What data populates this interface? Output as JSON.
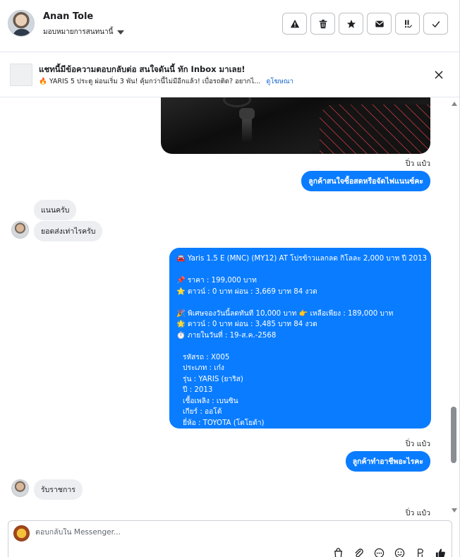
{
  "header": {
    "name": "Anan Tole",
    "assign_label": "มอบหมายการสนทนานี้",
    "actions": [
      {
        "icon": "alert-icon",
        "glyph": "!"
      },
      {
        "icon": "trash-icon",
        "glyph": "🗑"
      },
      {
        "icon": "star-icon",
        "glyph": "★"
      },
      {
        "icon": "envelope-icon",
        "glyph": "✉"
      },
      {
        "icon": "follow-up-icon",
        "glyph": "!!"
      },
      {
        "icon": "check-icon",
        "glyph": "✓"
      }
    ]
  },
  "notice": {
    "title": "แชทนี้มีข้อความตอบกลับต่อ สนใจดันนี้ ทัก Inbox มาเลย!",
    "body": "🔥 YARIS 5 ประตู ผ่อนเริ่ม 3 พัน! คุ้มกว่านี้ไม่มีอีกแล้ว! เบื่อรถติด? อยากไ...",
    "link": "ดูโฆษณา"
  },
  "messages": {
    "sender_1": "ปิ่ว แป๋ว",
    "out_1": "ลูกค้าสนใจซื้อสดหรือจัดไฟแนนซ์คะ",
    "in_1": "แนนครับ",
    "in_2": "ยอดส่งเท่าไรครับ",
    "listing": {
      "title": "🚘 Yaris 1.5 E (MNC) (MY12) AT โปรข้าวแลกลด กิโลละ 2,000 บาท ปี 2013",
      "price": "📌 ราคา : 199,000 บาท",
      "down1": "⭐ ดาวน์ : 0 บาท ผ่อน : 3,669 บาท 84 งวด",
      "special": "🎉 พิเศษจองวันนี้ลดทันที 10,000 บาท 👉 เหลือเพียง : 189,000 บาท",
      "down2": "🌟 ดาวน์ : 0 บาท ผ่อน : 3,485 บาท 84 งวด",
      "deadline": "⏱️ ภายในวันที่ : 19-ส.ค.-2568",
      "code": "รหัสรถ : X005",
      "type": "ประเภท : เก๋ง",
      "model": "รุ่น : YARIS (ยาริส)",
      "year": "ปี : 2013",
      "fuel": "เชื้อเพลิง : เบนซิน",
      "gear": "เกียร์ : ออโต้",
      "brand": "ยี่ห้อ : TOYOTA (โตโยต้า)"
    },
    "sender_2": "ปิ่ว แป๋ว",
    "out_2": "ลูกค้าทำอาชีพอะไรคะ",
    "in_3": "รับราชการ",
    "sender_3": "ปิ่ว แป๋ว"
  },
  "composer": {
    "placeholder": "ตอบกลับใน Messenger...",
    "tools": [
      "bag-icon",
      "paperclip-icon",
      "more-icon",
      "emoji-icon",
      "text-format-icon",
      "thumbs-up-icon"
    ]
  }
}
